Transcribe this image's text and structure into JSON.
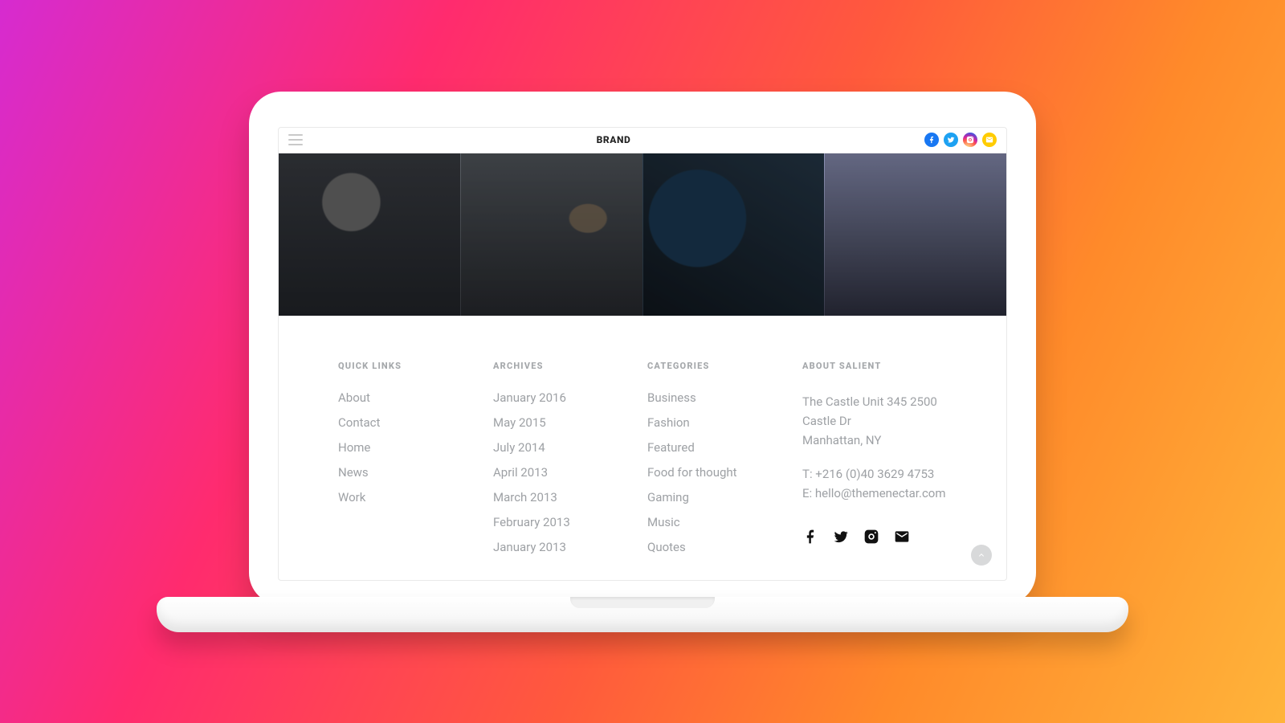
{
  "topbar": {
    "brand": "BRAND",
    "social": {
      "facebook": "Facebook",
      "twitter": "Twitter",
      "instagram": "Instagram",
      "email": "Email"
    }
  },
  "hero": {
    "tiles": [
      "photo-1",
      "photo-2",
      "photo-3",
      "photo-4"
    ]
  },
  "footer": {
    "quick_links": {
      "heading": "QUICK LINKS",
      "items": [
        "About",
        "Contact",
        "Home",
        "News",
        "Work"
      ]
    },
    "archives": {
      "heading": "ARCHIVES",
      "items": [
        "January 2016",
        "May 2015",
        "July 2014",
        "April 2013",
        "March 2013",
        "February 2013",
        "January 2013"
      ]
    },
    "categories": {
      "heading": "CATEGORIES",
      "items": [
        "Business",
        "Fashion",
        "Featured",
        "Food for thought",
        "Gaming",
        "Music",
        "Quotes"
      ]
    },
    "about": {
      "heading": "ABOUT SALIENT",
      "address_line1": "The Castle Unit 345 2500",
      "address_line2": "Castle Dr",
      "address_line3": "Manhattan, NY",
      "phone_label": "T: +216 (0)40 3629 4753",
      "email_label": "E: hello@themenectar.com"
    }
  },
  "icons": {
    "hamburger": "menu-icon",
    "to_top": "chevron-up-icon"
  }
}
